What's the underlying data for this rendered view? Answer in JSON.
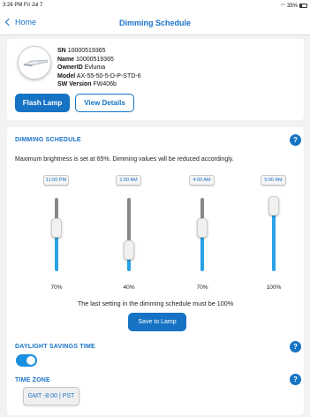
{
  "status_bar": {
    "time": "3:26 PM  Fri Jul 7",
    "battery": "35%"
  },
  "nav": {
    "back_label": "Home",
    "title": "Dimming Schedule"
  },
  "device": {
    "sn_label": "SN",
    "sn": "10000519365",
    "name_label": "Name",
    "name": "10000519365",
    "owner_label": "OwnerID",
    "owner": "Evluma",
    "model_label": "Model",
    "model": "AX-55-50-5-D-P-STD-6",
    "sw_label": "SW Version",
    "sw": "FW406b",
    "flash_label": "Flash Lamp",
    "details_label": "View Details"
  },
  "dimming": {
    "title": "DIMMING SCHEDULE",
    "help": "?",
    "note": "Maximum brightness is set at 65%. Dimming values will be reduced accordingly.",
    "colors": {
      "fill": "#29a3e8",
      "track": "#888888"
    },
    "slots": [
      {
        "time": "11:00 PM",
        "percent_label": "70%",
        "level": 70
      },
      {
        "time": "1:00 AM",
        "percent_label": "40%",
        "level": 40
      },
      {
        "time": "4:00 AM",
        "percent_label": "70%",
        "level": 70
      },
      {
        "time": "5:00 AM",
        "percent_label": "100%",
        "level": 100
      }
    ],
    "footer_note": "The last setting in the dimming schedule must be 100%",
    "save_label": "Save to Lamp"
  },
  "dst": {
    "title": "DAYLIGHT SAVINGS TIME",
    "help": "?",
    "enabled": true
  },
  "timezone": {
    "title": "TIME ZONE",
    "help": "?",
    "value": "GMT -8:00 | PST"
  }
}
